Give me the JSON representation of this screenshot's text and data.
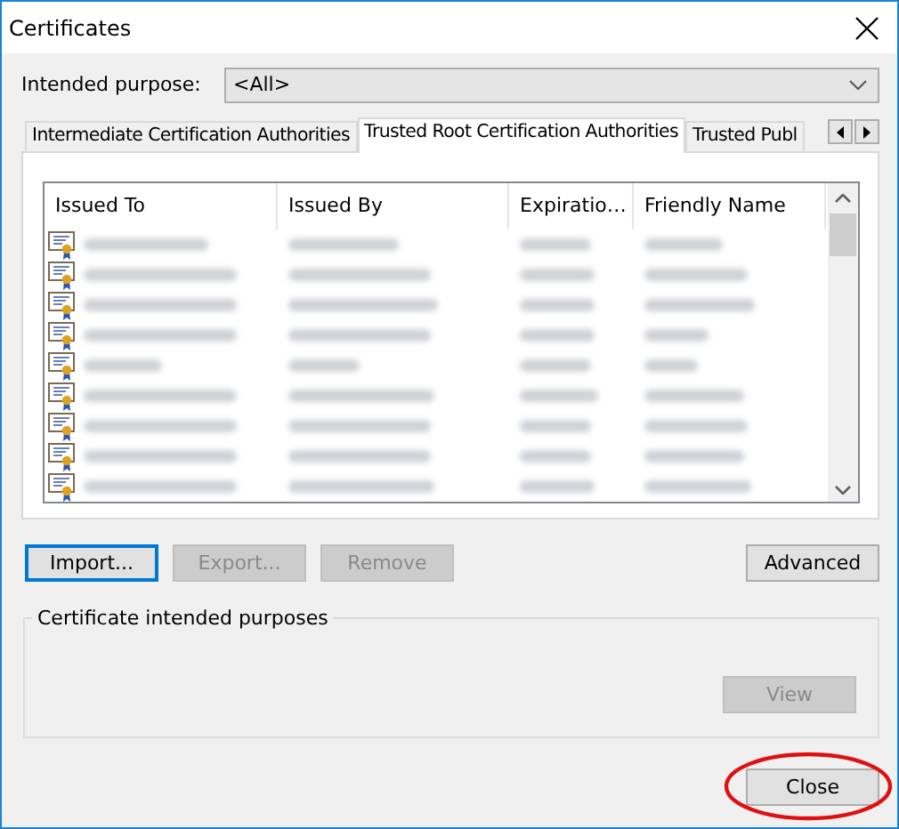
{
  "window": {
    "title": "Certificates"
  },
  "intended_purpose": {
    "label": "Intended purpose:",
    "value": "<All>"
  },
  "tabs": [
    {
      "label": "Intermediate Certification Authorities",
      "selected": false
    },
    {
      "label": "Trusted Root Certification Authorities",
      "selected": true
    },
    {
      "label": "Trusted Publ",
      "selected": false
    }
  ],
  "table": {
    "columns": [
      "Issued To",
      "Issued By",
      "Expiratio…",
      "Friendly Name"
    ],
    "rows": [
      {
        "kind": "redacted"
      },
      {
        "kind": "redacted"
      },
      {
        "kind": "redacted"
      },
      {
        "kind": "redacted"
      },
      {
        "kind": "redacted"
      },
      {
        "kind": "redacted"
      },
      {
        "kind": "redacted"
      },
      {
        "kind": "redacted"
      },
      {
        "kind": "redacted"
      }
    ]
  },
  "buttons": [
    {
      "label": "Import...",
      "disabled": false,
      "focused": true
    },
    {
      "label": "Export...",
      "disabled": true,
      "focused": false
    },
    {
      "label": "Remove",
      "disabled": true,
      "focused": false
    }
  ],
  "advanced_button": {
    "label": "Advanced",
    "disabled": false
  },
  "purposes_group": {
    "title": "Certificate intended purposes",
    "view_button": {
      "label": "View",
      "disabled": true
    }
  },
  "close_button": {
    "label": "Close",
    "circled": true
  }
}
